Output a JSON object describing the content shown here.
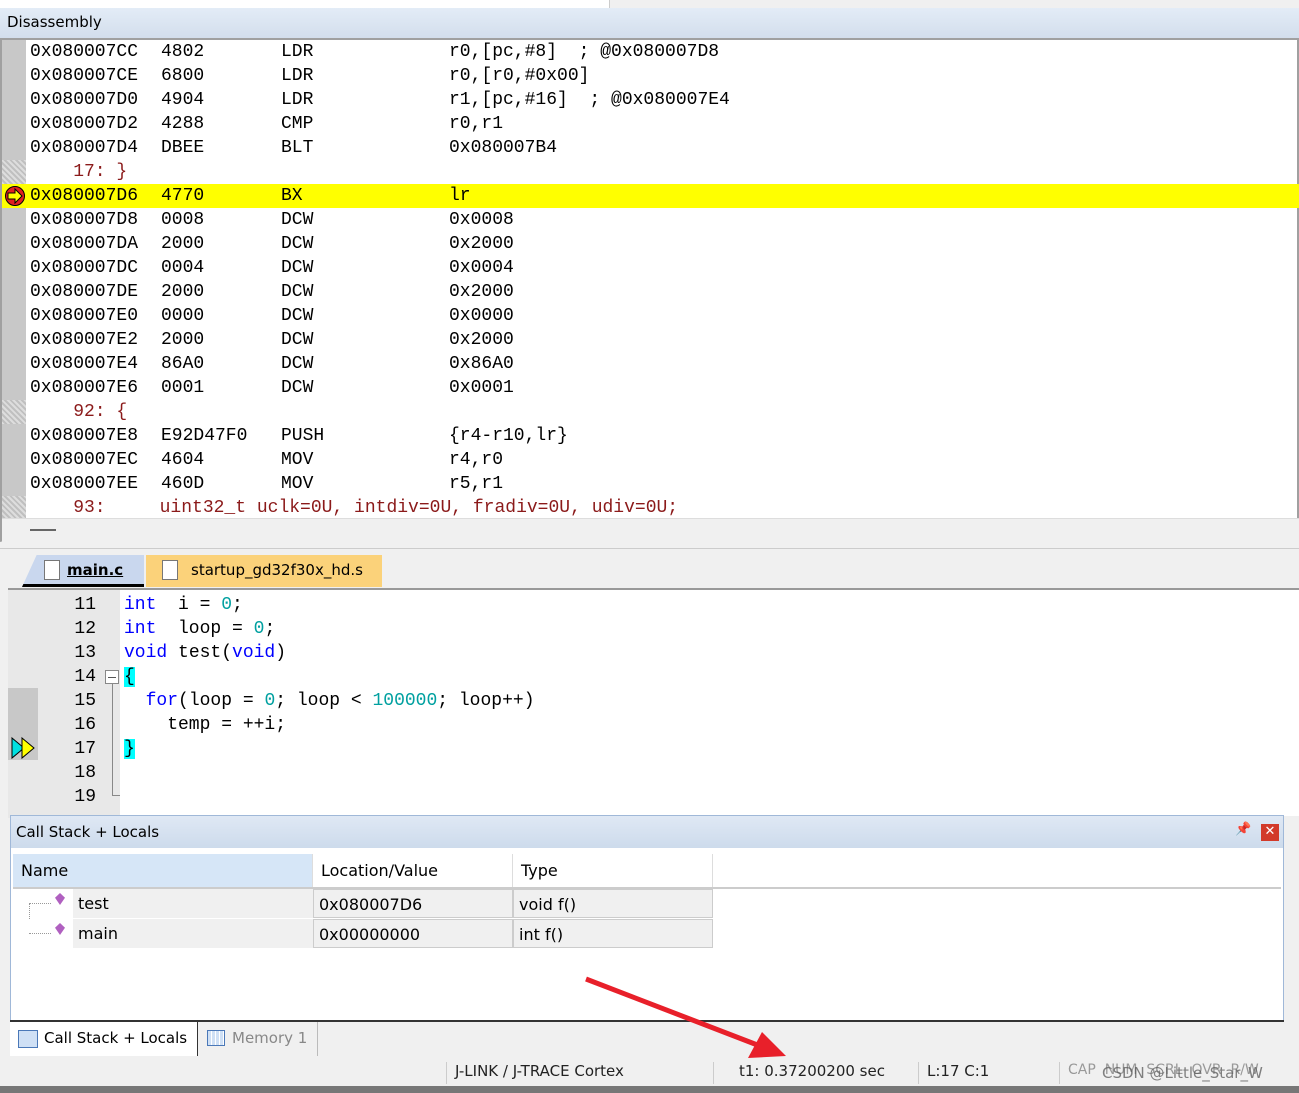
{
  "disassembly": {
    "title": "Disassembly",
    "rows": [
      {
        "addr": "0x080007CC",
        "op": "4802",
        "mn": "LDR",
        "args": "r0,[pc,#8]  ; @0x080007D8"
      },
      {
        "addr": "0x080007CE",
        "op": "6800",
        "mn": "LDR",
        "args": "r0,[r0,#0x00]"
      },
      {
        "addr": "0x080007D0",
        "op": "4904",
        "mn": "LDR",
        "args": "r1,[pc,#16]  ; @0x080007E4"
      },
      {
        "addr": "0x080007D2",
        "op": "4288",
        "mn": "CMP",
        "args": "r0,r1"
      },
      {
        "addr": "0x080007D4",
        "op": "DBEE",
        "mn": "BLT",
        "args": "0x080007B4"
      },
      {
        "src": "    17: }"
      },
      {
        "addr": "0x080007D6",
        "op": "4770",
        "mn": "BX",
        "args": "lr",
        "current": true
      },
      {
        "addr": "0x080007D8",
        "op": "0008",
        "mn": "DCW",
        "args": "0x0008"
      },
      {
        "addr": "0x080007DA",
        "op": "2000",
        "mn": "DCW",
        "args": "0x2000"
      },
      {
        "addr": "0x080007DC",
        "op": "0004",
        "mn": "DCW",
        "args": "0x0004"
      },
      {
        "addr": "0x080007DE",
        "op": "2000",
        "mn": "DCW",
        "args": "0x2000"
      },
      {
        "addr": "0x080007E0",
        "op": "0000",
        "mn": "DCW",
        "args": "0x0000"
      },
      {
        "addr": "0x080007E2",
        "op": "2000",
        "mn": "DCW",
        "args": "0x2000"
      },
      {
        "addr": "0x080007E4",
        "op": "86A0",
        "mn": "DCW",
        "args": "0x86A0"
      },
      {
        "addr": "0x080007E6",
        "op": "0001",
        "mn": "DCW",
        "args": "0x0001"
      },
      {
        "src": "    92: {"
      },
      {
        "addr": "0x080007E8",
        "op": "E92D47F0",
        "mn": "PUSH",
        "args": "{r4-r10,lr}"
      },
      {
        "addr": "0x080007EC",
        "op": "4604",
        "mn": "MOV",
        "args": "r4,r0"
      },
      {
        "addr": "0x080007EE",
        "op": "460D",
        "mn": "MOV",
        "args": "r5,r1"
      },
      {
        "src": "    93:     uint32_t uclk=0U, intdiv=0U, fradiv=0U, udiv=0U;"
      }
    ]
  },
  "tabs": [
    {
      "label": "main.c",
      "active": true
    },
    {
      "label": "startup_gd32f30x_hd.s",
      "active": false
    }
  ],
  "editor": {
    "lines": [
      {
        "n": "11",
        "parts": [
          [
            "kw",
            "int"
          ],
          [
            "",
            "  i = "
          ],
          [
            "num",
            "0"
          ],
          [
            "",
            ";"
          ]
        ]
      },
      {
        "n": "12",
        "parts": [
          [
            "kw",
            "int"
          ],
          [
            "",
            "  loop = "
          ],
          [
            "num",
            "0"
          ],
          [
            "",
            ";"
          ]
        ]
      },
      {
        "n": "13",
        "parts": [
          [
            "kw",
            "void"
          ],
          [
            "",
            " test("
          ],
          [
            "kw",
            "void"
          ],
          [
            "",
            ")"
          ]
        ]
      },
      {
        "n": "14",
        "parts": [
          [
            "brace",
            "{"
          ]
        ]
      },
      {
        "n": "15",
        "parts": [
          [
            "",
            "  "
          ],
          [
            "kw",
            "for"
          ],
          [
            "",
            "(loop = "
          ],
          [
            "num",
            "0"
          ],
          [
            "",
            "; loop < "
          ],
          [
            "num",
            "100000"
          ],
          [
            "",
            "; loop++)"
          ]
        ]
      },
      {
        "n": "16",
        "parts": [
          [
            "",
            "    temp = ++i;"
          ]
        ]
      },
      {
        "n": "17",
        "parts": [
          [
            "brace",
            "}"
          ]
        ]
      },
      {
        "n": "18",
        "parts": []
      },
      {
        "n": "19",
        "parts": []
      }
    ]
  },
  "callstack": {
    "title": "Call Stack + Locals",
    "headers": [
      "Name",
      "Location/Value",
      "Type"
    ],
    "rows": [
      {
        "name": "test",
        "value": "0x080007D6",
        "type": "void f()"
      },
      {
        "name": "main",
        "value": "0x00000000",
        "type": "int f()"
      }
    ]
  },
  "bottom_tabs": [
    "Call Stack + Locals",
    "Memory 1"
  ],
  "status": {
    "target": "J-LINK / J-TRACE Cortex",
    "time": "t1: 0.37200200 sec",
    "pos": "L:17 C:1",
    "caps": "CAP  NUM  SCRL  OVR  R/W"
  },
  "watermark": "CSDN @Little_Star_W",
  "colors": {
    "current_line": "#ffff00",
    "arrow": "#e8202a"
  }
}
